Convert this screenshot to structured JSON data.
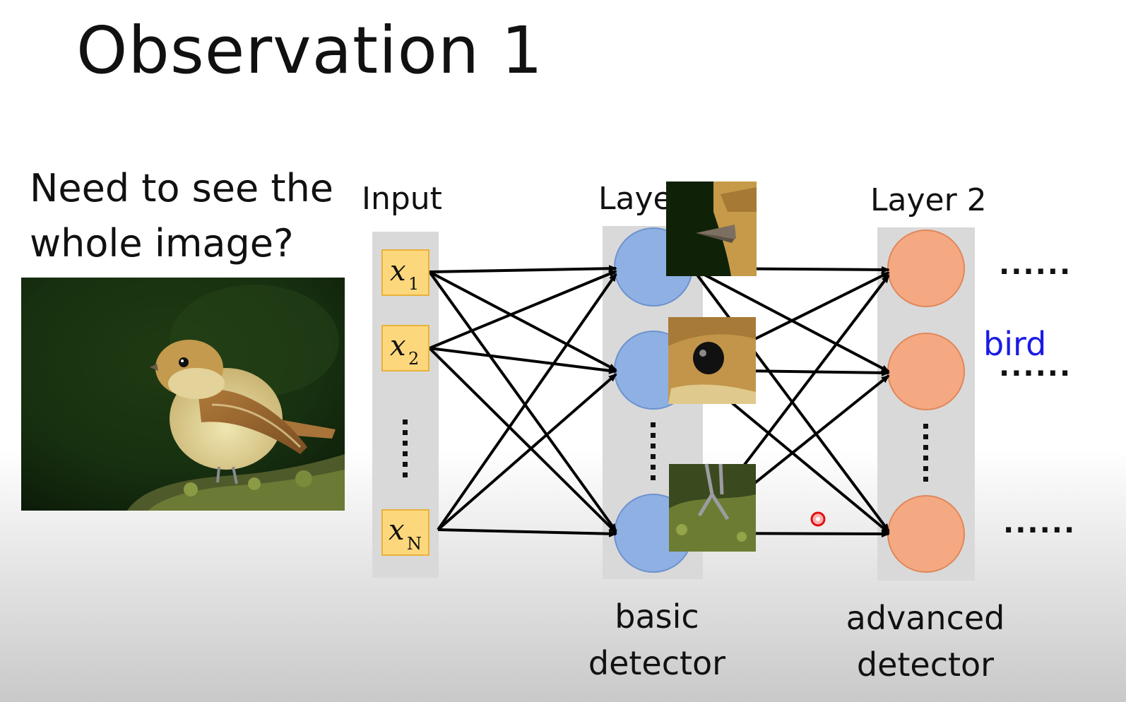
{
  "slide": {
    "title": "Observation 1",
    "question_line1": "Need to see the",
    "question_line2": "whole image?"
  },
  "network": {
    "input_label": "Input",
    "layer1_label": "Layer 1",
    "layer2_label": "Layer 2",
    "inputs": [
      {
        "var": "x",
        "sub": "1"
      },
      {
        "var": "x",
        "sub": "2"
      },
      {
        "var": "x",
        "sub": "N"
      }
    ],
    "layer1_caption_line1": "basic",
    "layer1_caption_line2": "detector",
    "layer2_caption_line1": "advanced",
    "layer2_caption_line2": "detector",
    "ellipsis": "......",
    "output_label": "bird"
  },
  "colors": {
    "input_box": "#fdd77c",
    "input_border": "#e9b23a",
    "layer1_node": "#8fb0e3",
    "layer2_node": "#f5a982",
    "column_bg": "#d9d9d9",
    "output_label": "#1a1ae6",
    "pointer": "#e01010"
  }
}
